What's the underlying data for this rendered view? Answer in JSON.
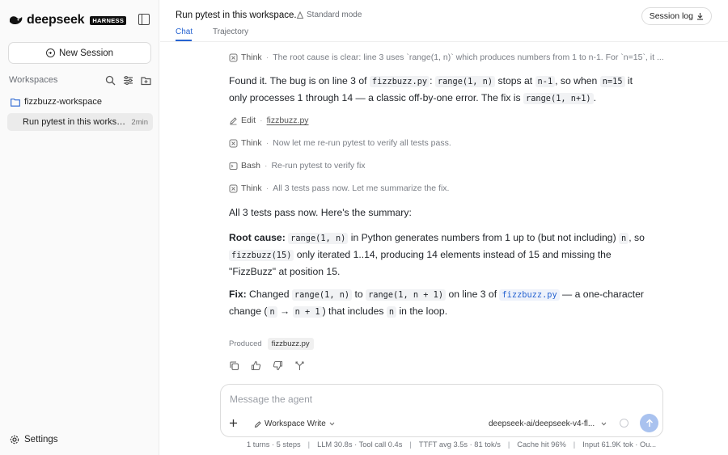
{
  "sidebar": {
    "brand": "deepseek",
    "badge": "HARNESS",
    "new_session_label": "New Session",
    "workspaces_title": "Workspaces",
    "workspace_name": "fizzbuzz-workspace",
    "session_label": "Run pytest in this workspace.",
    "session_time": "2min",
    "settings_label": "Settings"
  },
  "header": {
    "title": "Run pytest in this workspace.",
    "mode": "Standard mode",
    "session_log": "Session log",
    "tabs": [
      {
        "label": "Chat",
        "active": true
      },
      {
        "label": "Trajectory",
        "active": false
      }
    ]
  },
  "conversation": {
    "step_think_1": {
      "kind": "Think",
      "text": "The root cause is clear: line 3 uses `range(1, n)` which produces numbers from 1 to n-1. For `n=15`, it ..."
    },
    "p1": {
      "t1": "Found it. The bug is on line 3 of ",
      "c1": "fizzbuzz.py",
      "t2": ": ",
      "c2": "range(1, n)",
      "t3": " stops at ",
      "c3": "n-1",
      "t4": ", so when ",
      "c4": "n=15",
      "t5": " it only processes 1 through 14 — a classic off-by-one error. The fix is ",
      "c5": "range(1, n+1)",
      "t6": "."
    },
    "step_edit": {
      "kind": "Edit",
      "text": "fizzbuzz.py"
    },
    "step_think_2": {
      "kind": "Think",
      "text": "Now let me re-run pytest to verify all tests pass."
    },
    "step_bash": {
      "kind": "Bash",
      "text": "Re-run pytest to verify fix"
    },
    "step_think_3": {
      "kind": "Think",
      "text": "All 3 tests pass now. Let me summarize the fix."
    },
    "p2": "All 3 tests pass now. Here's the summary:",
    "p3": {
      "b": "Root cause:",
      "c1": "range(1, n)",
      "t1": " in Python generates numbers from 1 up to (but not including) ",
      "c2": "n",
      "t2": ", so ",
      "c3": "fizzbuzz(15)",
      "t3": " only iterated 1..14, producing 14 elements instead of 15 and missing the \"FizzBuzz\" at position 15."
    },
    "p4": {
      "b": "Fix:",
      "t1": " Changed ",
      "c1": "range(1, n)",
      "t2": " to ",
      "c2": "range(1, n + 1)",
      "t3": " on line 3 of ",
      "c3": "fizzbuzz.py",
      "t4": " — a one-character change (",
      "c4": "n",
      "arrow": "→",
      "c5": "n + 1",
      "t5": ") that includes ",
      "c6": "n",
      "t6": " in the loop."
    },
    "produced_label": "Produced",
    "produced_file": "fizzbuzz.py"
  },
  "composer": {
    "placeholder": "Message the agent",
    "mode": "Workspace Write",
    "model": "deepseek-ai/deepseek-v4-fl..."
  },
  "stats": {
    "turns": "1 turns · 5 steps",
    "llm": "LLM 30.8s · Tool call 0.4s",
    "ttft": "TTFT avg 3.5s · 81 tok/s",
    "cache": "Cache hit 96%",
    "input": "Input 61.9K tok · Ou..."
  },
  "colors": {
    "accent": "#2663d1",
    "send_button": "#a9c2ef"
  }
}
